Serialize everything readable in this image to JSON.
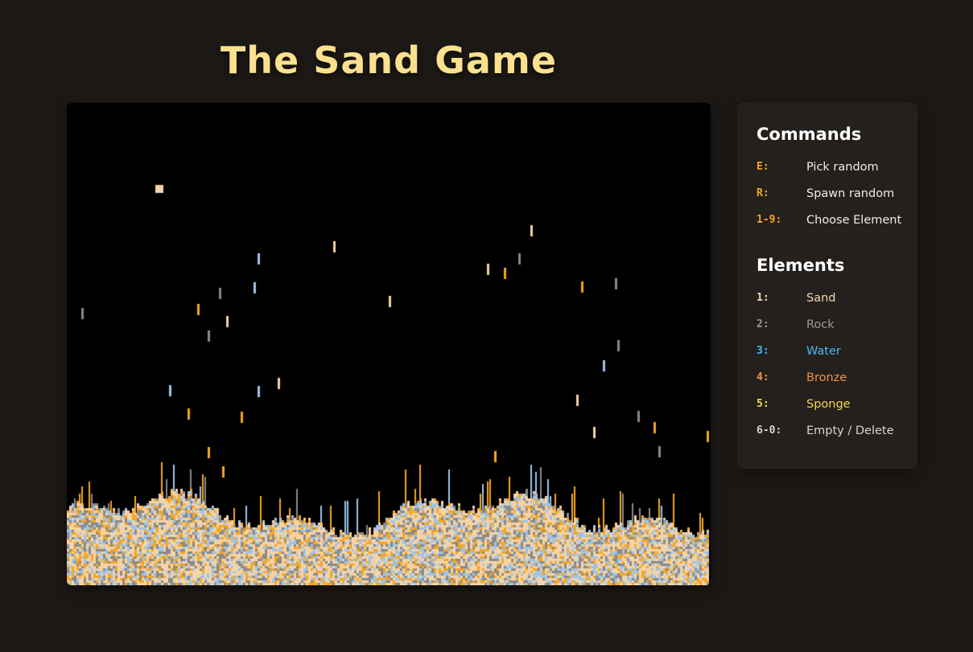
{
  "title": "The Sand Game",
  "commands": {
    "heading": "Commands",
    "items": [
      {
        "key": "E:",
        "label": "Pick random",
        "key_color": "#f5a623",
        "label_color": "#f3ece2"
      },
      {
        "key": "R:",
        "label": "Spawn random",
        "key_color": "#f5a623",
        "label_color": "#f3ece2"
      },
      {
        "key": "1-9:",
        "label": "Choose Element",
        "key_color": "#f5a623",
        "label_color": "#f3ece2"
      }
    ]
  },
  "elements": {
    "heading": "Elements",
    "items": [
      {
        "key": "1:",
        "label": "Sand",
        "color": "#f5d7b0"
      },
      {
        "key": "2:",
        "label": "Rock",
        "color": "#9b9b9b"
      },
      {
        "key": "3:",
        "label": "Water",
        "color": "#4db8f0"
      },
      {
        "key": "4:",
        "label": "Bronze",
        "color": "#f0934a"
      },
      {
        "key": "5:",
        "label": "Sponge",
        "color": "#f5d84a"
      },
      {
        "key": "6-0:",
        "label": "Empty / Delete",
        "color": "#d8d4d0"
      }
    ]
  },
  "particle_colors": {
    "sand": "#f4d3a7",
    "rock": "#8a8a8a",
    "water": "#9fc4e8",
    "bronze": "#f5a623",
    "background": "#000000"
  }
}
